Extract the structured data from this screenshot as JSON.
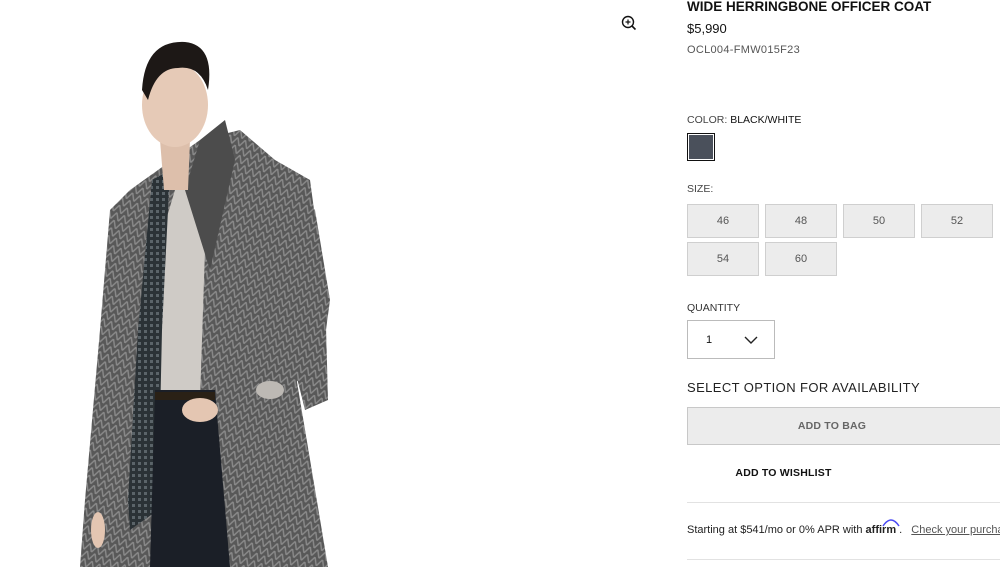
{
  "gallery": {
    "zoom_icon": "zoom-in-icon"
  },
  "product": {
    "title": "WIDE HERRINGBONE OFFICER COAT",
    "price": "$5,990",
    "sku": "OCL004-FMW015F23"
  },
  "color": {
    "label": "COLOR:",
    "value": "BLACK/WHITE",
    "swatch_hex": "#4a505b"
  },
  "size": {
    "label": "SIZE:",
    "options": [
      "46",
      "48",
      "50",
      "52",
      "54",
      "60"
    ]
  },
  "quantity": {
    "label": "QUANTITY",
    "value": "1",
    "icon": "chevron-down-icon"
  },
  "availability_text": "SELECT OPTION FOR AVAILABILITY",
  "buttons": {
    "add_to_bag": "ADD TO BAG",
    "add_to_wishlist": "ADD TO WISHLIST"
  },
  "financing": {
    "text": "Starting at $541/mo or 0% APR with",
    "brand": "affirm",
    "link": "Check your purchasing power"
  }
}
